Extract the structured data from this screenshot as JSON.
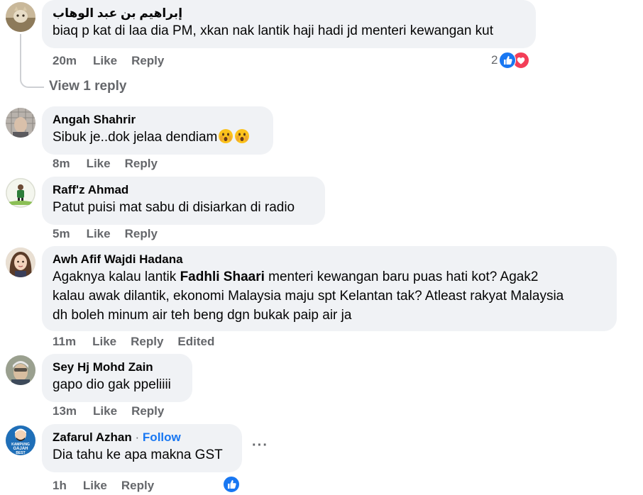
{
  "comments": [
    {
      "author": "إبراهيم بن عبد الوهاب",
      "text": "biaq p kat di laa dia PM, xkan nak lantik haji hadi jd menteri kewangan kut",
      "time": "20m",
      "like": "Like",
      "reply": "Reply",
      "reaction_count": "2",
      "reaction_icons": [
        "like-icon",
        "love-icon"
      ],
      "view_replies": "View 1 reply"
    },
    {
      "author": "Angah Shahrir",
      "text": "Sibuk je..dok jelaa dendiam",
      "emoji": [
        "astonished-face-icon",
        "astonished-face-icon"
      ],
      "time": "8m",
      "like": "Like",
      "reply": "Reply"
    },
    {
      "author": "Raff'z Ahmad",
      "text": "Patut puisi mat sabu di disiarkan di radio",
      "time": "5m",
      "like": "Like",
      "reply": "Reply"
    },
    {
      "author": "Awh Afif Wajdi Hadana",
      "text_pre": "Agaknya kalau lantik ",
      "text_bold": "Fadhli Shaari",
      "text_post": " menteri kewangan baru puas hati kot? Agak2",
      "text_line2": "kalau awak dilantik, ekonomi Malaysia maju spt Kelantan tak? Atleast rakyat Malaysia",
      "text_line3": "dh boleh minum air teh beng dgn bukak paip air ja",
      "time": "11m",
      "like": "Like",
      "reply": "Reply",
      "edited": "Edited"
    },
    {
      "author": "Sey Hj Mohd Zain",
      "text": "gapo dio gak ppeliiii",
      "time": "13m",
      "like": "Like",
      "reply": "Reply"
    },
    {
      "author": "Zafarul Azhan",
      "separator": "·",
      "follow": "Follow",
      "text": "Dia tahu ke apa makna GST",
      "time": "1h",
      "like": "Like",
      "reply": "Reply",
      "reaction_icons": [
        "like-icon"
      ],
      "more": "···",
      "avatar_text": [
        "KAMPUNG",
        "GAJAH",
        "BEST"
      ]
    }
  ],
  "colors": {
    "bubble": "#f0f2f5",
    "muted": "#65676b",
    "link": "#1877f2",
    "like": "#1877f2",
    "love": "#f33e58"
  }
}
